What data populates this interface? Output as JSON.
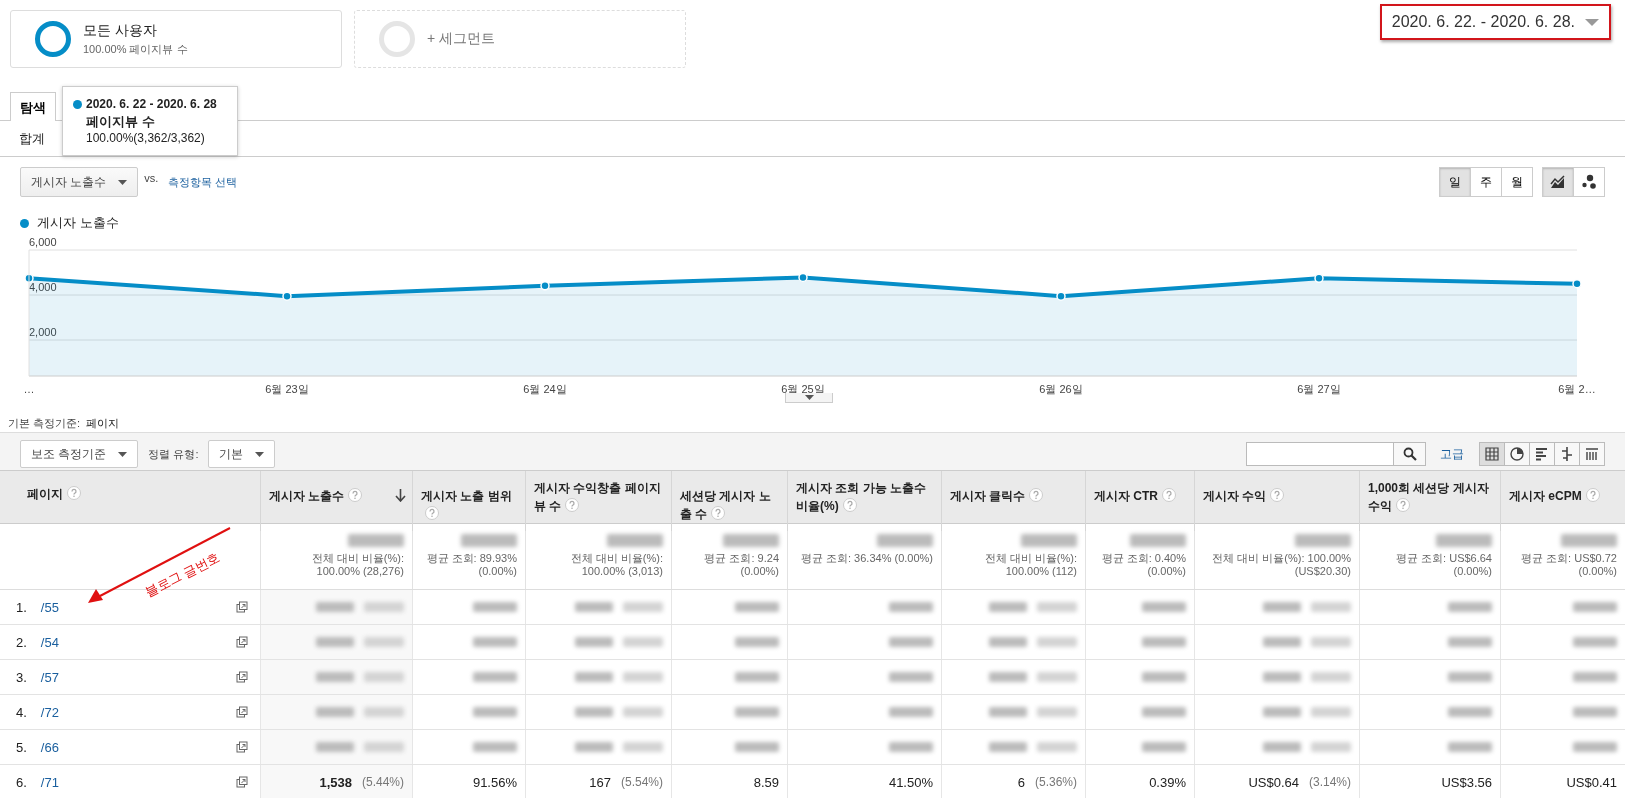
{
  "segments": [
    {
      "kind": "active",
      "title": "모든 사용자",
      "subtitle": "100.00% 페이지뷰 수"
    },
    {
      "kind": "add",
      "title": "+ 세그먼트"
    }
  ],
  "date_range": "2020. 6. 22. - 2020. 6. 28.",
  "tabs": [
    {
      "label": "탐색",
      "selected": true
    }
  ],
  "subtab": "합계",
  "tooltip": {
    "title": "2020. 6. 22 - 2020. 6. 28",
    "metric": "페이지뷰 수",
    "value": "100.00%(3,362/3,362)",
    "color": "#058dc7"
  },
  "metric_select": "게시자 노출수",
  "vs": "vs.",
  "compare_link": "측정항목 선택",
  "period_buttons": [
    {
      "label": "일",
      "selected": true
    },
    {
      "label": "주",
      "selected": false
    },
    {
      "label": "월",
      "selected": false
    }
  ],
  "chart_type_buttons": [
    {
      "kind": "line",
      "selected": true
    },
    {
      "kind": "motion",
      "selected": false
    }
  ],
  "chart_data": {
    "type": "area",
    "categories": [
      "…",
      "6월 23일",
      "6월 24일",
      "6월 25일",
      "6월 26일",
      "6월 27일",
      "6월 2…"
    ],
    "series": [
      {
        "name": "게시자 노출수",
        "color": "#058dc7",
        "values": [
          4740,
          3950,
          4410,
          4780,
          3950,
          4740,
          4500
        ]
      }
    ],
    "ylim": [
      400,
      6000
    ],
    "grid": true,
    "yticks": [
      {
        "value": 2000,
        "label": "2,000"
      },
      {
        "value": 4000,
        "label": "4,000"
      },
      {
        "value": 6000,
        "label": "6,000"
      }
    ]
  },
  "primary_dimension": {
    "label": "기본 측정기준:",
    "value": "페이지"
  },
  "secondary_dimension": "보조 측정기준",
  "sort_label": "정렬 유형:",
  "sort_value": "기본",
  "advanced_link": "고급",
  "view_buttons": [
    {
      "kind": "table",
      "selected": true
    },
    {
      "kind": "pie",
      "selected": false
    },
    {
      "kind": "bar",
      "selected": false
    },
    {
      "kind": "comparison",
      "selected": false
    },
    {
      "kind": "pivot",
      "selected": false
    }
  ],
  "table": {
    "columns": [
      {
        "label": "페이지",
        "sorted": false
      },
      {
        "label": "게시자 노출수",
        "sorted": true
      },
      {
        "label": "게시자 노출 범위",
        "sorted": false
      },
      {
        "label": "게시자 수익창출 페이지뷰 수",
        "sorted": false
      },
      {
        "label": "세션당 게시자 노출 수",
        "sorted": false
      },
      {
        "label": "게시자 조회 가능 노출수 비율(%)",
        "sorted": false
      },
      {
        "label": "게시자 클릭수",
        "sorted": false
      },
      {
        "label": "게시자 CTR",
        "sorted": false
      },
      {
        "label": "게시자 수익",
        "sorted": false
      },
      {
        "label": "1,000회 세션당 게시자 수익",
        "sorted": false
      },
      {
        "label": "게시자 eCPM",
        "sorted": false
      }
    ],
    "totals": [
      {
        "lines": [
          "전체 대비 비율(%):",
          "100.00% (28,276)"
        ]
      },
      {
        "lines": [
          "평균 조회: 89.93%",
          "(0.00%)"
        ]
      },
      {
        "lines": [
          "전체 대비 비율(%):",
          "100.00% (3,013)"
        ]
      },
      {
        "lines": [
          "평균 조회: 9.24",
          "(0.00%)"
        ]
      },
      {
        "lines": [
          "평균 조회: 36.34% (0.00%)"
        ]
      },
      {
        "lines": [
          "전체 대비 비율(%):",
          "100.00% (112)"
        ]
      },
      {
        "lines": [
          "평균 조회: 0.40%",
          "(0.00%)"
        ]
      },
      {
        "lines": [
          "전체 대비 비율(%): 100.00%",
          "(US$20.30)"
        ]
      },
      {
        "lines": [
          "평균 조회: US$6.64",
          "(0.00%)"
        ]
      },
      {
        "lines": [
          "평균 조회: US$0.72",
          "(0.00%)"
        ]
      }
    ],
    "rows": [
      {
        "cells": [
          {
            "kind": "page",
            "index": "1.",
            "page": "/55"
          },
          {
            "kind": "blurred_pair"
          },
          {
            "kind": "blurred"
          },
          {
            "kind": "blurred_pair"
          },
          {
            "kind": "blurred"
          },
          {
            "kind": "blurred"
          },
          {
            "kind": "blurred_pair"
          },
          {
            "kind": "blurred"
          },
          {
            "kind": "blurred_pair"
          },
          {
            "kind": "blurred"
          },
          {
            "kind": "blurred"
          }
        ]
      },
      {
        "cells": [
          {
            "kind": "page",
            "index": "2.",
            "page": "/54"
          },
          {
            "kind": "blurred_pair"
          },
          {
            "kind": "blurred"
          },
          {
            "kind": "blurred_pair"
          },
          {
            "kind": "blurred"
          },
          {
            "kind": "blurred"
          },
          {
            "kind": "blurred_pair"
          },
          {
            "kind": "blurred"
          },
          {
            "kind": "blurred_pair"
          },
          {
            "kind": "blurred"
          },
          {
            "kind": "blurred"
          }
        ]
      },
      {
        "cells": [
          {
            "kind": "page",
            "index": "3.",
            "page": "/57"
          },
          {
            "kind": "blurred_pair"
          },
          {
            "kind": "blurred"
          },
          {
            "kind": "blurred_pair"
          },
          {
            "kind": "blurred"
          },
          {
            "kind": "blurred"
          },
          {
            "kind": "blurred_pair"
          },
          {
            "kind": "blurred"
          },
          {
            "kind": "blurred_pair"
          },
          {
            "kind": "blurred"
          },
          {
            "kind": "blurred"
          }
        ]
      },
      {
        "cells": [
          {
            "kind": "page",
            "index": "4.",
            "page": "/72"
          },
          {
            "kind": "blurred_pair"
          },
          {
            "kind": "blurred"
          },
          {
            "kind": "blurred_pair"
          },
          {
            "kind": "blurred"
          },
          {
            "kind": "blurred"
          },
          {
            "kind": "blurred_pair"
          },
          {
            "kind": "blurred"
          },
          {
            "kind": "blurred_pair"
          },
          {
            "kind": "blurred"
          },
          {
            "kind": "blurred"
          }
        ]
      },
      {
        "cells": [
          {
            "kind": "page",
            "index": "5.",
            "page": "/66"
          },
          {
            "kind": "blurred_pair"
          },
          {
            "kind": "blurred"
          },
          {
            "kind": "blurred_pair"
          },
          {
            "kind": "blurred"
          },
          {
            "kind": "blurred"
          },
          {
            "kind": "blurred_pair"
          },
          {
            "kind": "blurred"
          },
          {
            "kind": "blurred_pair"
          },
          {
            "kind": "blurred"
          },
          {
            "kind": "blurred"
          }
        ]
      },
      {
        "cells": [
          {
            "kind": "page",
            "index": "6.",
            "page": "/71"
          },
          {
            "kind": "text",
            "value": "1,538",
            "share": "(5.44%)"
          },
          {
            "kind": "text",
            "value": "91.56%"
          },
          {
            "kind": "text",
            "value": "167",
            "share": "(5.54%)"
          },
          {
            "kind": "text",
            "value": "8.59"
          },
          {
            "kind": "text",
            "value": "41.50%"
          },
          {
            "kind": "text",
            "value": "6",
            "share": "(5.36%)"
          },
          {
            "kind": "text",
            "value": "0.39%"
          },
          {
            "kind": "text",
            "value": "US$0.64",
            "share": "(3.14%)"
          },
          {
            "kind": "text",
            "value": "US$3.56"
          },
          {
            "kind": "text",
            "value": "US$0.41"
          }
        ]
      }
    ]
  },
  "annotation": {
    "text": "블로그 글번호",
    "color": "#e01010"
  }
}
